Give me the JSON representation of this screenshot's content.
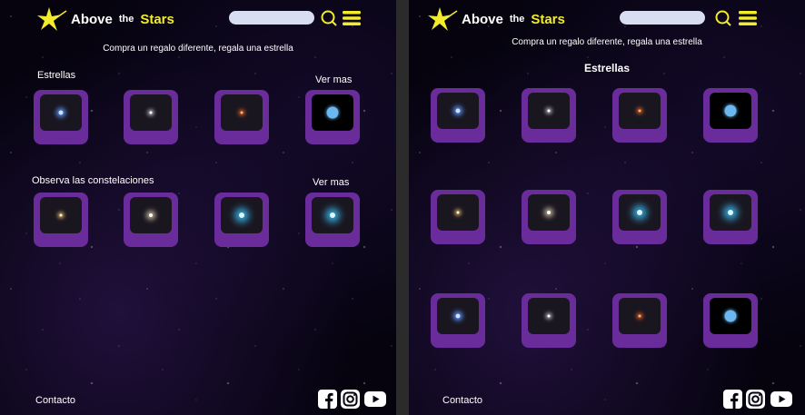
{
  "brand": {
    "word1": "Above",
    "word2": "the",
    "word3": "Stars"
  },
  "tagline": "Compra un regalo diferente, regala una estrella",
  "left": {
    "section1_label": "Estrellas",
    "section1_link": "Ver mas",
    "section2_label": "Observa las constelaciones",
    "section2_link": "Ver mas"
  },
  "right": {
    "heading": "Estrellas"
  },
  "footer": {
    "contact": "Contacto"
  },
  "icons": {
    "logo": "star-logo-icon",
    "search": "search-icon",
    "menu": "hamburger-menu-icon",
    "facebook": "facebook-icon",
    "instagram": "instagram-icon",
    "youtube": "youtube-icon"
  },
  "colors": {
    "accent_yellow": "#f2ec2c",
    "tile_purple": "#6a2b9b",
    "search_bg": "#d9ddf2",
    "bg": "#06030f"
  },
  "tile_types": [
    "blue-star",
    "white-star",
    "orange-star",
    "blue-planet",
    "yellow-star",
    "warm-white-star",
    "cyan-star"
  ],
  "left_tiles": [
    "blue-star",
    "white-star",
    "orange-star",
    "blue-planet",
    "yellow-star",
    "warm-white-star",
    "cyan-star",
    "cyan-star"
  ],
  "right_tiles": [
    "blue-star",
    "white-star",
    "orange-star",
    "blue-planet",
    "yellow-star",
    "warm-white-star",
    "cyan-star",
    "cyan-star",
    "blue-star",
    "white-star",
    "orange-star",
    "blue-planet"
  ]
}
